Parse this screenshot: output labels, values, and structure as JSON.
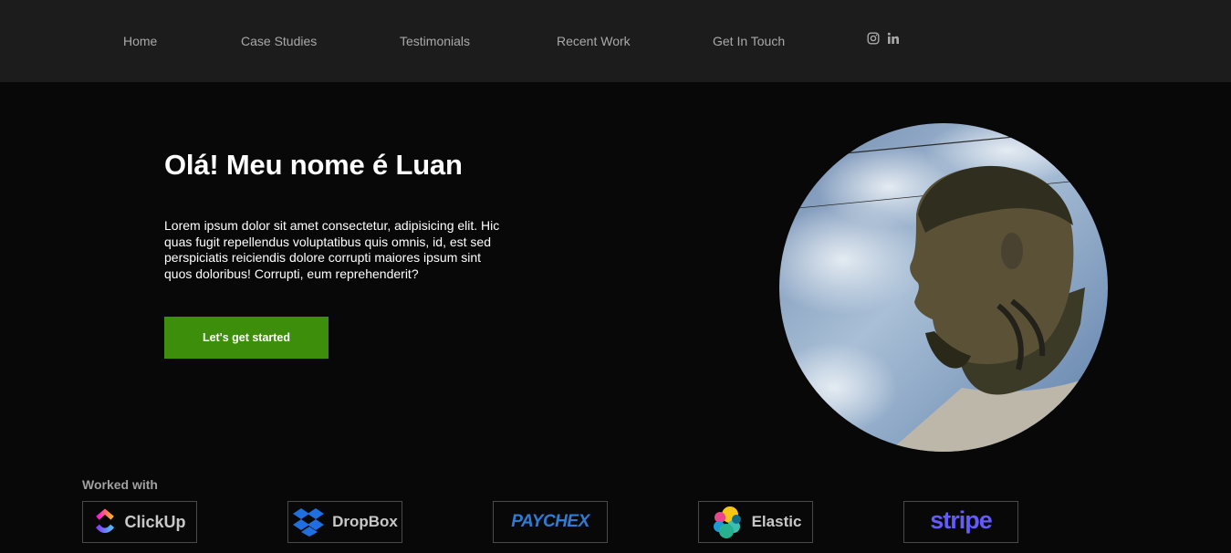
{
  "nav": {
    "items": [
      {
        "label": "Home"
      },
      {
        "label": "Case Studies"
      },
      {
        "label": "Testimonials"
      },
      {
        "label": "Recent Work"
      },
      {
        "label": "Get In Touch"
      }
    ],
    "social": [
      {
        "icon": "instagram-icon"
      },
      {
        "icon": "linkedin-icon"
      }
    ]
  },
  "hero": {
    "title": "Olá! Meu nome é Luan",
    "body": "Lorem ipsum dolor sit amet consectetur, adipisicing elit. Hic quas fugit repellendus voluptatibus quis omnis, id, est sed perspiciatis reiciendis dolore corrupti maiores ipsum sint quos doloribus! Corrupti, eum reprehenderit?",
    "cta_label": "Let's get started",
    "cta_color": "#3d8f0b"
  },
  "worked_with": {
    "heading": "Worked with",
    "brands": [
      {
        "label": "ClickUp",
        "icon": "clickup-logo-icon"
      },
      {
        "label": "DropBox",
        "icon": "dropbox-logo-icon",
        "color": "#1f6fe0"
      },
      {
        "label": "PAYCHEX",
        "color": "#2f7bd2"
      },
      {
        "label": "Elastic",
        "icon": "elastic-logo-icon"
      },
      {
        "label": "stripe",
        "color": "#635bff"
      }
    ]
  }
}
